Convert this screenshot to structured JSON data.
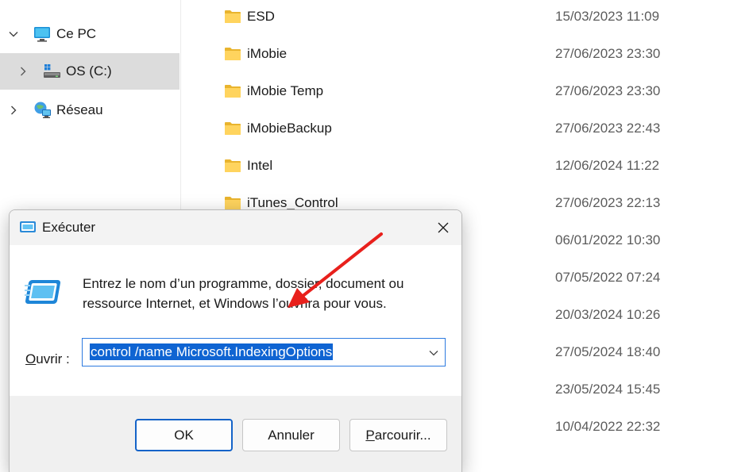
{
  "nav": {
    "items": [
      {
        "label": "Ce PC",
        "icon": "monitor-icon",
        "expanded": true
      },
      {
        "label": "OS (C:)",
        "icon": "drive-icon",
        "expanded": false,
        "selected": true
      },
      {
        "label": "Réseau",
        "icon": "network-icon",
        "expanded": false
      }
    ]
  },
  "files": [
    {
      "name": "ESD",
      "date": "15/03/2023 11:09"
    },
    {
      "name": "iMobie",
      "date": "27/06/2023 23:30"
    },
    {
      "name": "iMobie Temp",
      "date": "27/06/2023 23:30"
    },
    {
      "name": "iMobieBackup",
      "date": "27/06/2023 22:43"
    },
    {
      "name": "Intel",
      "date": "12/06/2024 11:22"
    },
    {
      "name": "iTunes_Control",
      "date": "27/06/2023 22:13"
    },
    {
      "name": "",
      "date": "06/01/2022 10:30"
    },
    {
      "name": "",
      "date": "07/05/2022 07:24"
    },
    {
      "name": "",
      "date": "20/03/2024 10:26"
    },
    {
      "name": "",
      "date": "27/05/2024 18:40"
    },
    {
      "name": "",
      "date": "23/05/2024 15:45"
    },
    {
      "name": "",
      "date": "10/04/2022 22:32"
    }
  ],
  "dialog": {
    "title": "Exécuter",
    "description": "Entrez le nom d’un programme, dossier, document ou ressource Internet, et Windows l’ouvrira pour vous.",
    "open_label_accesskey": "O",
    "open_label_rest": "uvrir :",
    "input_value": "control /name Microsoft.IndexingOptions",
    "buttons": {
      "ok": "OK",
      "cancel": "Annuler",
      "browse_accesskey": "P",
      "browse_rest": "arcourir..."
    }
  },
  "colors": {
    "selection": "#0f64d2",
    "annotation_arrow": "#e8201c",
    "folder": "#f7c948"
  }
}
